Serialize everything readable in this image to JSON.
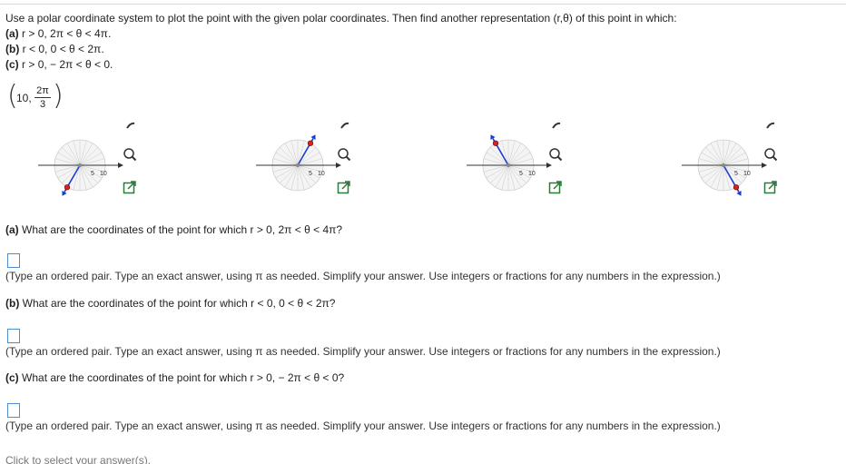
{
  "problem": {
    "instruction": "Use a polar coordinate system to plot the point with the given polar coordinates. Then find another representation (r,θ) of this point in which:",
    "conditions": [
      {
        "label": "(a)",
        "text": "r > 0, 2π < θ < 4π."
      },
      {
        "label": "(b)",
        "text": "r < 0, 0 < θ < 2π."
      },
      {
        "label": "(c)",
        "text": "r > 0,  − 2π < θ < 0."
      }
    ],
    "point": {
      "r": "10,",
      "num": "2π",
      "den": "3"
    }
  },
  "graphs": [
    {
      "label_a": "5",
      "label_b": "10",
      "angle_deg": 240
    },
    {
      "label_a": "5",
      "label_b": "10",
      "angle_deg": 60
    },
    {
      "label_a": "5",
      "label_b": "10",
      "angle_deg": 120
    },
    {
      "label_a": "5",
      "label_b": "10",
      "angle_deg": 300
    }
  ],
  "icons": {
    "zoom": "magnifier-icon",
    "expand": "expand-icon",
    "tool": "key-icon"
  },
  "questions": [
    {
      "label": "(a)",
      "text": "What are the coordinates of the point for which r > 0, 2π < θ < 4π?",
      "hint": "(Type an ordered pair. Type an exact answer, using π as needed. Simplify your answer. Use integers or fractions for any numbers in the expression.)"
    },
    {
      "label": "(b)",
      "text": "What are the coordinates of the point for which r < 0, 0 < θ < 2π?",
      "hint": "(Type an ordered pair. Type an exact answer, using π as needed. Simplify your answer. Use integers or fractions for any numbers in the expression.)"
    },
    {
      "label": "(c)",
      "text": "What are the coordinates of the point for which r > 0,  − 2π < θ < 0?",
      "hint": "(Type an ordered pair. Type an exact answer, using π as needed. Simplify your answer. Use integers or fractions for any numbers in the expression.)"
    }
  ],
  "footer": {
    "text": "Click to select your answer(s)."
  },
  "colors": {
    "accent": "#4a8fd0",
    "point": "#e02020",
    "arrow": "#1a3fd0"
  }
}
